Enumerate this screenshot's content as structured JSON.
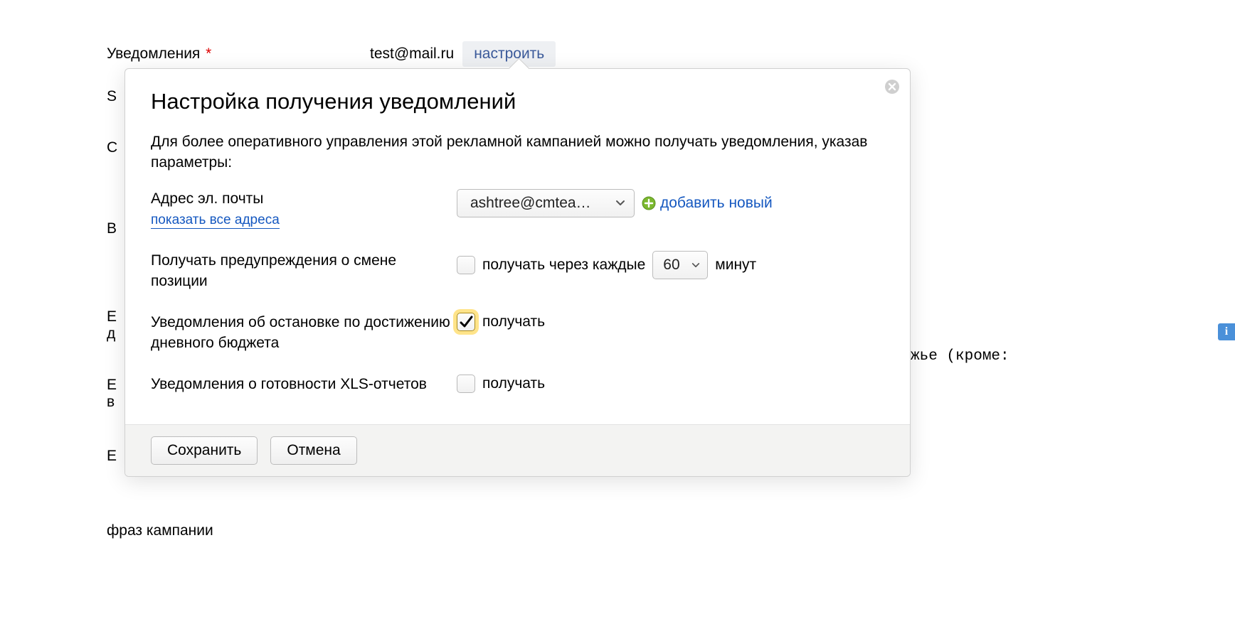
{
  "background": {
    "notifications_label": "Уведомления",
    "required_mark": "*",
    "email_value": "test@mail.ru",
    "configure_label": "настроить",
    "row_letters": [
      "S",
      "С",
      "В",
      "Е\nд",
      "Е\nв",
      "Е"
    ],
    "tail_text": "жье (кроме:",
    "phrase_text": "фраз кампании"
  },
  "info_badge": "i",
  "popup": {
    "title": "Настройка получения уведомлений",
    "description": "Для более оперативного управления этой рекламной кампанией можно получать уведомления, указав параметры:",
    "email_section": {
      "label": "Адрес эл. почты",
      "show_all": "показать все адреса",
      "selected_email": "ashtree@cmtea…",
      "add_new_label": "добавить новый"
    },
    "position_section": {
      "label": "Получать предупреждения о смене позиции",
      "checkbox_label": "получать через каждые",
      "interval_value": "60",
      "unit": "минут",
      "checked": false
    },
    "budget_section": {
      "label": "Уведомления об остановке по достижению дневного бюджета",
      "checkbox_label": "получать",
      "checked": true
    },
    "xls_section": {
      "label": "Уведомления о готовности XLS-отчетов",
      "checkbox_label": "получать",
      "checked": false
    },
    "footer": {
      "save": "Сохранить",
      "cancel": "Отмена"
    }
  }
}
